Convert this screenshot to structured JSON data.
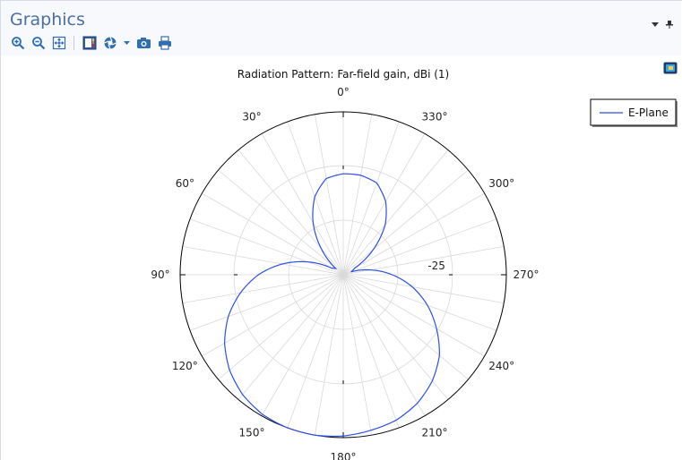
{
  "panel": {
    "title": "Graphics"
  },
  "toolbar": {
    "buttons": [
      "zoom-in",
      "zoom-out",
      "zoom-extents",
      "show-legends",
      "color-scheme",
      "scene-light-dropdown",
      "image-snapshot",
      "print"
    ]
  },
  "colors": {
    "title": "#4a6fa5",
    "series": "#2b4fe8",
    "grid": "#d9d9d9",
    "outer_circle": "#000000"
  },
  "chart_data": {
    "type": "line",
    "polar": true,
    "title": "Radiation Pattern: Far-field gain, dBi (1)",
    "angle_direction": "counterclockwise",
    "zero_location": "top",
    "angle_tick_labels": [
      "0°",
      "30°",
      "60°",
      "90°",
      "120°",
      "150°",
      "180°",
      "210°",
      "240°",
      "270°",
      "300°",
      "330°"
    ],
    "radial_tick_labels": [
      "-25"
    ],
    "grid": true,
    "legend": {
      "entries": [
        "E-Plane"
      ],
      "placement": "top-right"
    },
    "series": [
      {
        "name": "E-Plane",
        "angle_deg": [
          0,
          10,
          20,
          30,
          40,
          50,
          60,
          70,
          80,
          90,
          100,
          110,
          120,
          130,
          140,
          150,
          160,
          170,
          180,
          190,
          200,
          210,
          220,
          230,
          240,
          250,
          260,
          270,
          280,
          290,
          300,
          310,
          320,
          330,
          340,
          350,
          360
        ],
        "radius_fraction": [
          0.62,
          0.6,
          0.51,
          0.37,
          0.21,
          0.06,
          0.08,
          0.23,
          0.38,
          0.52,
          0.64,
          0.75,
          0.84,
          0.91,
          0.96,
          0.99,
          1.0,
          1.0,
          0.99,
          0.97,
          0.95,
          0.91,
          0.85,
          0.77,
          0.66,
          0.55,
          0.43,
          0.3,
          0.17,
          0.05,
          0.08,
          0.24,
          0.4,
          0.52,
          0.6,
          0.62,
          0.62
        ]
      }
    ]
  }
}
